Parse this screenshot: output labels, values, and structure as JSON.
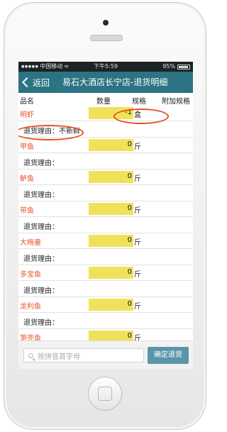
{
  "status_bar": {
    "carrier": "中国移动",
    "wifi_icon": "wifi-icon",
    "time": "下午5:59",
    "battery": "95%",
    "battery_level": 0.95
  },
  "nav": {
    "back_label": "返回",
    "title": "易石大酒店长宁店-退货明细"
  },
  "table": {
    "columns": [
      "品名",
      "数量",
      "规格",
      "附加规格"
    ],
    "reason_label": "退货理由：",
    "items": [
      {
        "name": "明虾",
        "quantity": "-1",
        "unit": "盒",
        "reason": "不新鲜"
      },
      {
        "name": "甲鱼",
        "quantity": "0",
        "unit": "斤",
        "reason": ""
      },
      {
        "name": "鲈鱼",
        "quantity": "0",
        "unit": "斤",
        "reason": ""
      },
      {
        "name": "带鱼",
        "quantity": "0",
        "unit": "斤",
        "reason": ""
      },
      {
        "name": "大梅童",
        "quantity": "0",
        "unit": "斤",
        "reason": ""
      },
      {
        "name": "多宝鱼",
        "quantity": "0",
        "unit": "斤",
        "reason": ""
      },
      {
        "name": "龙利鱼",
        "quantity": "0",
        "unit": "斤",
        "reason": ""
      },
      {
        "name": "笋壳鱼",
        "quantity": "0",
        "unit": "斤",
        "reason": ""
      }
    ]
  },
  "bottom": {
    "search_placeholder": "按拼音首字母",
    "confirm_label": "确定退货"
  },
  "colors": {
    "nav_bg": "#2c7384",
    "item_name": "#e8562a",
    "qty_bg": "#efe25a",
    "confirm_bg": "#5a96a7",
    "annotation": "#ea4b1c"
  }
}
